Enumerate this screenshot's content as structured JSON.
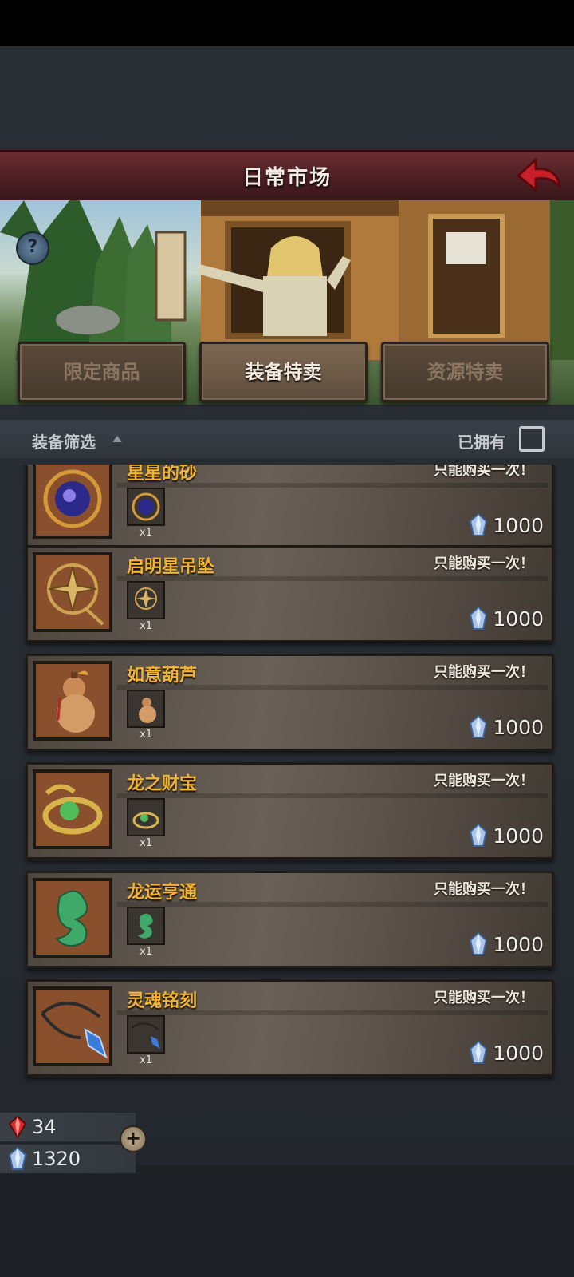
{
  "header": {
    "title": "日常市场"
  },
  "tabs": [
    {
      "label": "限定商品",
      "active": false
    },
    {
      "label": "装备特卖",
      "active": true
    },
    {
      "label": "资源特卖",
      "active": false
    }
  ],
  "filter": {
    "label": "装备筛选",
    "owned_label": "已拥有",
    "owned_checked": false
  },
  "items": [
    {
      "name": "星星的砂",
      "limit": "只能购买一次！",
      "qty": "x1",
      "price": "1000",
      "icon": "starry-orb-icon"
    },
    {
      "name": "启明星吊坠",
      "limit": "只能购买一次！",
      "qty": "x1",
      "price": "1000",
      "icon": "compass-star-pendant-icon"
    },
    {
      "name": "如意葫芦",
      "limit": "只能购买一次！",
      "qty": "x1",
      "price": "1000",
      "icon": "gourd-icon"
    },
    {
      "name": "龙之财宝",
      "limit": "只能购买一次！",
      "qty": "x1",
      "price": "1000",
      "icon": "dragon-ring-icon"
    },
    {
      "name": "龙运亨通",
      "limit": "只能购买一次！",
      "qty": "x1",
      "price": "1000",
      "icon": "jade-dragon-icon"
    },
    {
      "name": "灵魂铭刻",
      "limit": "只能购买一次！",
      "qty": "x1",
      "price": "1000",
      "icon": "soul-crystal-necklace-icon"
    }
  ],
  "currency": {
    "red_gems": "34",
    "crystals": "1320"
  },
  "colors": {
    "header": "#4d1f24",
    "item_name": "#f3b431",
    "card": "#5f564d"
  }
}
